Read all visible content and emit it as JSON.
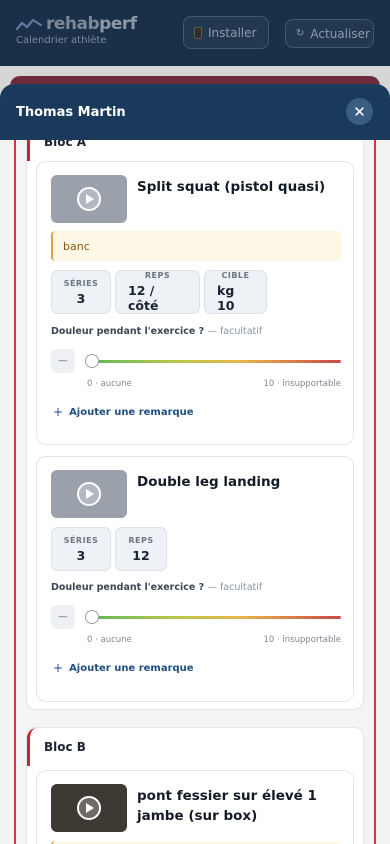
{
  "app": {
    "logo_part1": "rehab",
    "logo_part2": "perf",
    "subtitle": "Calendrier athlète",
    "install_label": "Installer",
    "refresh_label": "Actualiser",
    "refresh_glyph": "↻",
    "install_icon": "phone-icon"
  },
  "sheet": {
    "title": "Thomas Martin",
    "close_glyph": "✕",
    "close_icon": "close-icon"
  },
  "blocs": [
    {
      "title": "Bloc A"
    },
    {
      "title": "Bloc B"
    }
  ],
  "exercises": [
    {
      "title": "Split squat (pistol quasi)",
      "note": "banc",
      "stats": [
        {
          "label": "SÉRIES",
          "value": "3"
        },
        {
          "label": "REPS",
          "value": "12 / côté"
        },
        {
          "label": "CIBLE",
          "value": "kg 10"
        }
      ],
      "pain_label": "Douleur pendant l'exercice ?",
      "pain_optional": "— facultatif",
      "scale_min": "0 · aucune",
      "scale_max": "10 · insupportable",
      "pain_value": 0,
      "add_remark": "Ajouter une remarque"
    },
    {
      "title": "Double leg landing",
      "stats": [
        {
          "label": "SÉRIES",
          "value": "3"
        },
        {
          "label": "REPS",
          "value": "12"
        }
      ],
      "pain_label": "Douleur pendant l'exercice ?",
      "pain_optional": "— facultatif",
      "scale_min": "0 · aucune",
      "scale_max": "10 · insupportable",
      "pain_value": 0,
      "add_remark": "Ajouter une remarque"
    },
    {
      "title": "pont fessier sur élevé 1 jambe (sur box)"
    }
  ],
  "common": {
    "minus_glyph": "−",
    "plus_glyph": "+"
  },
  "colors": {
    "header_bg": "#1a2f48",
    "sheet_header_bg": "#1a3a5c",
    "accent_red": "#d9333f",
    "link_blue": "#1f4f82",
    "note_border": "#e2a24b"
  }
}
